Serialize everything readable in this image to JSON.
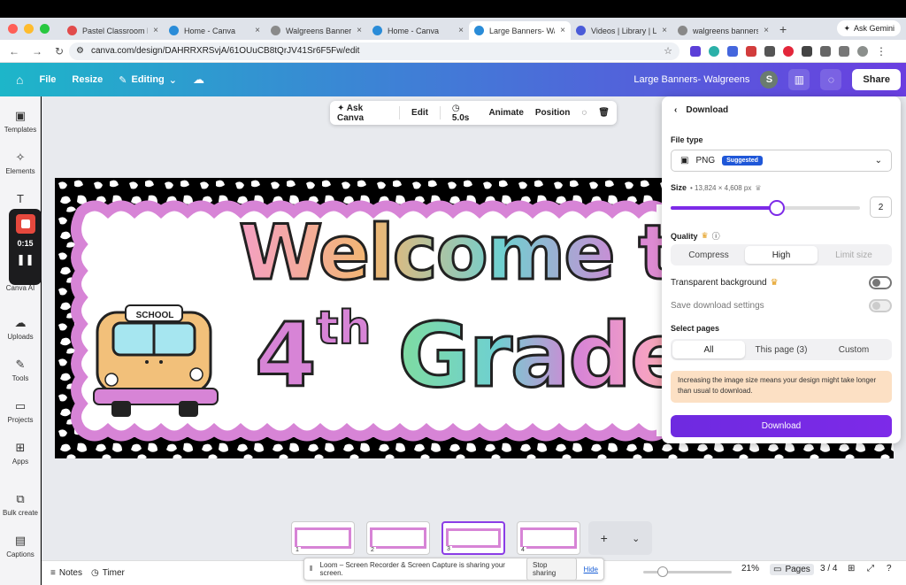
{
  "browser": {
    "tabs": [
      {
        "title": "Pastel Classroom Dec",
        "color": "#e14b4b"
      },
      {
        "title": "Home - Canva",
        "color": "#2a8cd8"
      },
      {
        "title": "Walgreens Banner Te",
        "color": "#8a8a8a"
      },
      {
        "title": "Home - Canva",
        "color": "#2a8cd8"
      },
      {
        "title": "Large Banners- Walg",
        "color": "#2a8cd8"
      },
      {
        "title": "Videos | Library | Loo",
        "color": "#4a5bd8"
      },
      {
        "title": "walgreens banners -",
        "color": "#888888"
      }
    ],
    "gemini": "Ask Gemini",
    "url": "canva.com/design/DAHRRXRSvjA/61OUuCB8tQrJV41Sr6F5Fw/edit"
  },
  "canva": {
    "file": "File",
    "resize": "Resize",
    "editing": "Editing",
    "design_title": "Large Banners- Walgreens",
    "avatar": "S",
    "share": "Share"
  },
  "sidebar": {
    "items": [
      {
        "label": "Templates",
        "icon": "template-icon"
      },
      {
        "label": "Elements",
        "icon": "elements-icon"
      },
      {
        "label": "Text",
        "icon": "text-icon"
      },
      {
        "label": "Canva AI",
        "icon": "ai-icon"
      },
      {
        "label": "Uploads",
        "icon": "upload-icon"
      },
      {
        "label": "Tools",
        "icon": "pen-icon"
      },
      {
        "label": "Projects",
        "icon": "folder-icon"
      },
      {
        "label": "Apps",
        "icon": "apps-icon"
      },
      {
        "label": "Bulk create",
        "icon": "bulk-icon"
      },
      {
        "label": "Captions",
        "icon": "captions-icon"
      }
    ]
  },
  "recorder": {
    "time": "0:15"
  },
  "toolbar": {
    "ask": "Ask Canva",
    "edit": "Edit",
    "duration": "5.0s",
    "animate": "Animate",
    "position": "Position"
  },
  "banner": {
    "line1": "Welcome to",
    "line2_num": "4",
    "line2_sup": "th",
    "line2_word": "Grade!",
    "bus_sign": "SCHOOL",
    "colors": {
      "purple": "#d784d6",
      "pink": "#f4a0c4",
      "orange": "#f2b671",
      "teal": "#6fd0d0",
      "green": "#7fdca0"
    }
  },
  "download": {
    "header": "Download",
    "file_type_label": "File type",
    "file_type": "PNG",
    "suggested": "Suggested",
    "size_label": "Size",
    "size_dims": "• 13,824 × 4,608 px",
    "size_value": "2",
    "size_level": 0.56,
    "quality_label": "Quality",
    "quality_options": [
      "Compress",
      "High",
      "Limit size"
    ],
    "transparent": "Transparent background",
    "save_settings": "Save download settings",
    "select_pages_label": "Select pages",
    "pages_options": [
      "All",
      "This page (3)",
      "Custom"
    ],
    "notice": "Increasing the image size means your design might take longer than usual to download.",
    "button": "Download",
    "accent": "#7d2ae8"
  },
  "filmstrip": {
    "pages": [
      "1",
      "2",
      "3",
      "4"
    ]
  },
  "bottom": {
    "notes": "Notes",
    "timer": "Timer",
    "zoom": "21%",
    "pages": "Pages",
    "page_count": "3 / 4"
  },
  "loom": {
    "message": "Loom – Screen Recorder & Screen Capture is sharing your screen.",
    "stop": "Stop sharing",
    "hide": "Hide"
  }
}
